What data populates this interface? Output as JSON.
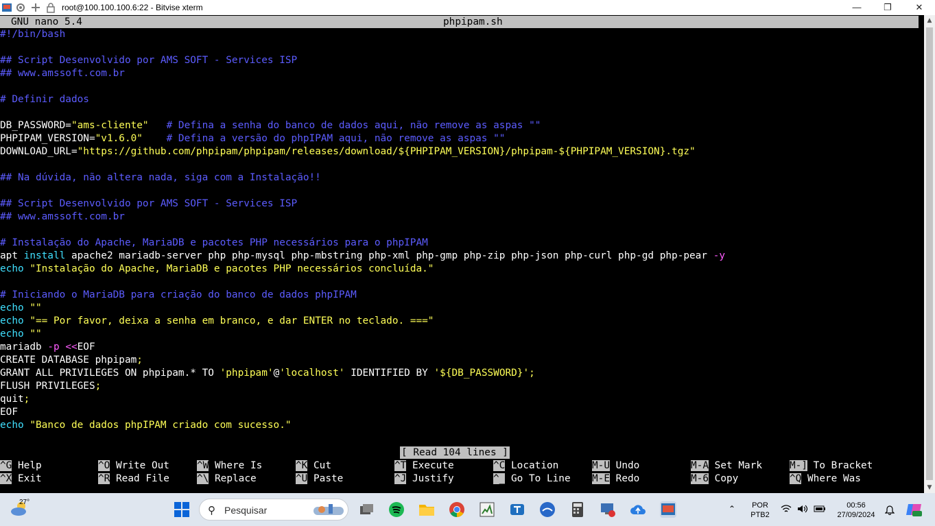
{
  "window": {
    "title": "root@100.100.100.6:22 - Bitvise xterm",
    "icons": [
      "bitvise-icon",
      "gear-icon",
      "plus-icon",
      "lock-icon"
    ],
    "controls": [
      "minimize-icon",
      "restore-icon",
      "close-icon"
    ]
  },
  "nano": {
    "version": "GNU nano 5.4",
    "filename": "phpipam.sh",
    "status": "[ Read 104 lines ]"
  },
  "colors": {
    "comment": "#5c5cff",
    "string": "#ffff57",
    "option": "#ff5cff",
    "builtin": "#40e0ff",
    "text": "#ffffff",
    "bar": "#c0c0c0"
  },
  "lines": [
    [
      {
        "t": "#!/bin/bash",
        "c": "b"
      }
    ],
    [],
    [
      {
        "t": "## Script Desenvolvido por AMS SOFT - Services ISP",
        "c": "b"
      }
    ],
    [
      {
        "t": "## www.amssoft.com.br",
        "c": "b"
      }
    ],
    [],
    [
      {
        "t": "# Definir dados",
        "c": "b"
      }
    ],
    [],
    [
      {
        "t": "DB_PASSWORD=",
        "c": "d"
      },
      {
        "t": "\"ams-cliente\"",
        "c": "y"
      },
      {
        "t": "   ",
        "c": "d"
      },
      {
        "t": "# Defina a senha do banco de dados aqui, não remove as aspas \"\"",
        "c": "b"
      }
    ],
    [
      {
        "t": "PHPIPAM_VERSION=",
        "c": "d"
      },
      {
        "t": "\"v1.6.0\"",
        "c": "y"
      },
      {
        "t": "    ",
        "c": "d"
      },
      {
        "t": "# Defina a versão do phpIPAM aqui, não remove as aspas \"\"",
        "c": "b"
      }
    ],
    [
      {
        "t": "DOWNLOAD_URL=",
        "c": "d"
      },
      {
        "t": "\"https://github.com/phpipam/phpipam/releases/download/${PHPIPAM_VERSION}/phpipam-${PHPIPAM_VERSION}.tgz\"",
        "c": "y"
      }
    ],
    [],
    [
      {
        "t": "## Na dúvida, não altera nada, siga com a Instalação!!",
        "c": "b"
      }
    ],
    [],
    [
      {
        "t": "## Script Desenvolvido por AMS SOFT - Services ISP",
        "c": "b"
      }
    ],
    [
      {
        "t": "## www.amssoft.com.br",
        "c": "b"
      }
    ],
    [],
    [
      {
        "t": "# Instalação do Apache, MariaDB e pacotes PHP necessários para o phpIPAM",
        "c": "b"
      }
    ],
    [
      {
        "t": "apt ",
        "c": "d"
      },
      {
        "t": "install",
        "c": "c"
      },
      {
        "t": " apache2 mariadb-server php php-mysql php-mbstring php-xml php-gmp php-zip php-json php-curl php-gd php-pear ",
        "c": "d"
      },
      {
        "t": "-y",
        "c": "m"
      }
    ],
    [
      {
        "t": "echo",
        "c": "c"
      },
      {
        "t": " ",
        "c": "d"
      },
      {
        "t": "\"Instalação do Apache, MariaDB e pacotes PHP necessários concluída.\"",
        "c": "y"
      }
    ],
    [],
    [
      {
        "t": "# Iniciando o MariaDB para criação do banco de dados phpIPAM",
        "c": "b"
      }
    ],
    [
      {
        "t": "echo",
        "c": "c"
      },
      {
        "t": " ",
        "c": "d"
      },
      {
        "t": "\"\"",
        "c": "y"
      }
    ],
    [
      {
        "t": "echo",
        "c": "c"
      },
      {
        "t": " ",
        "c": "d"
      },
      {
        "t": "\"== Por favor, deixa a senha em branco, e dar ENTER no teclado. ===\"",
        "c": "y"
      }
    ],
    [
      {
        "t": "echo",
        "c": "c"
      },
      {
        "t": " ",
        "c": "d"
      },
      {
        "t": "\"\"",
        "c": "y"
      }
    ],
    [
      {
        "t": "mariadb ",
        "c": "d"
      },
      {
        "t": "-p",
        "c": "m"
      },
      {
        "t": " ",
        "c": "d"
      },
      {
        "t": "<<",
        "c": "m"
      },
      {
        "t": "EOF",
        "c": "d"
      }
    ],
    [
      {
        "t": "CREATE DATABASE phpipam",
        "c": "d"
      },
      {
        "t": ";",
        "c": "y"
      }
    ],
    [
      {
        "t": "GRANT ALL PRIVILEGES ON phpipam.* TO ",
        "c": "d"
      },
      {
        "t": "'phpipam'",
        "c": "y"
      },
      {
        "t": "@",
        "c": "d"
      },
      {
        "t": "'localhost'",
        "c": "y"
      },
      {
        "t": " IDENTIFIED BY ",
        "c": "d"
      },
      {
        "t": "'${DB_PASSWORD}'",
        "c": "y"
      },
      {
        "t": ";",
        "c": "y"
      }
    ],
    [
      {
        "t": "FLUSH PRIVILEGES",
        "c": "d"
      },
      {
        "t": ";",
        "c": "y"
      }
    ],
    [
      {
        "t": "quit",
        "c": "d"
      },
      {
        "t": ";",
        "c": "y"
      }
    ],
    [
      {
        "t": "EOF",
        "c": "d"
      }
    ],
    [
      {
        "t": "echo",
        "c": "c"
      },
      {
        "t": " ",
        "c": "d"
      },
      {
        "t": "\"Banco de dados phpIPAM criado com sucesso.\"",
        "c": "y"
      }
    ]
  ],
  "shortcuts": [
    {
      "key": "^G",
      "label": "Help"
    },
    {
      "key": "^X",
      "label": "Exit"
    },
    {
      "key": "^O",
      "label": "Write Out"
    },
    {
      "key": "^R",
      "label": "Read File"
    },
    {
      "key": "^W",
      "label": "Where Is"
    },
    {
      "key": "^\\",
      "label": "Replace"
    },
    {
      "key": "^K",
      "label": "Cut"
    },
    {
      "key": "^U",
      "label": "Paste"
    },
    {
      "key": "^T",
      "label": "Execute"
    },
    {
      "key": "^J",
      "label": "Justify"
    },
    {
      "key": "^C",
      "label": "Location"
    },
    {
      "key": "^_",
      "label": "Go To Line"
    },
    {
      "key": "M-U",
      "label": "Undo"
    },
    {
      "key": "M-E",
      "label": "Redo"
    },
    {
      "key": "M-A",
      "label": "Set Mark"
    },
    {
      "key": "M-6",
      "label": "Copy"
    },
    {
      "key": "M-]",
      "label": "To Bracket"
    },
    {
      "key": "^Q",
      "label": "Where Was"
    }
  ],
  "taskbar": {
    "weather": "27°",
    "search_placeholder": "Pesquisar",
    "apps": [
      "start-icon",
      "widgets-icon",
      "task-view-icon",
      "spotify-icon",
      "file-explorer-icon",
      "chrome-icon",
      "winbox-icon",
      "teams-icon",
      "vpn-icon",
      "calculator-icon",
      "network-app-icon",
      "cloud-icon",
      "bitvise-icon"
    ],
    "language": "POR",
    "keyboard": "PTB2",
    "time": "00:56",
    "date": "27/09/2024"
  }
}
